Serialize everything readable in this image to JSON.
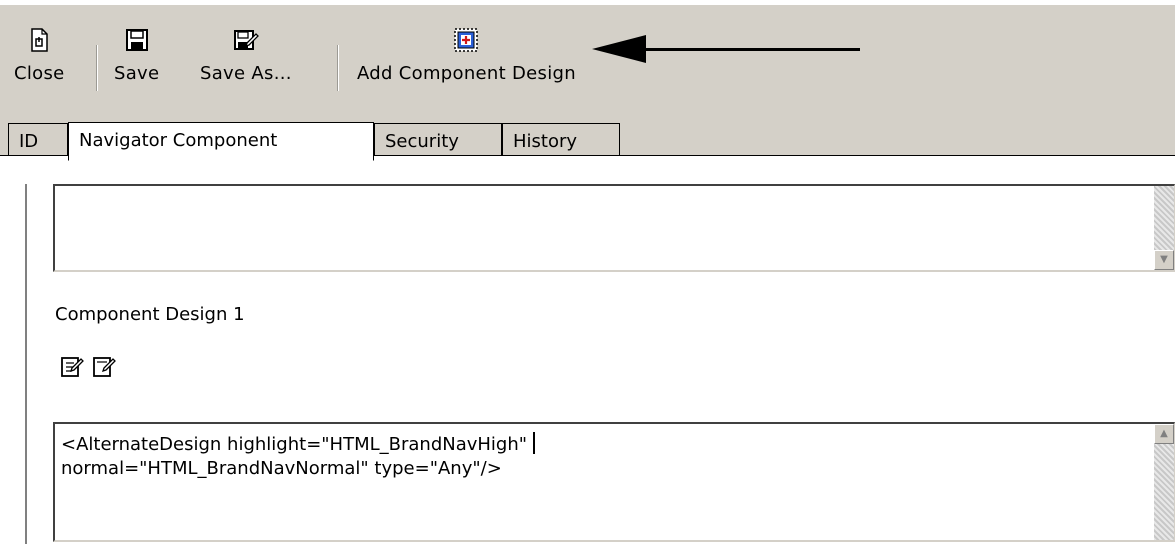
{
  "toolbar": {
    "close_label": "Close",
    "save_label": "Save",
    "save_as_label": "Save As...",
    "add_component_design_label": "Add Component Design"
  },
  "tabs": [
    {
      "label": "ID"
    },
    {
      "label": "Navigator Component"
    },
    {
      "label": "Security"
    },
    {
      "label": "History"
    }
  ],
  "section": {
    "title": "Component Design 1"
  },
  "design_editor": {
    "line1": "<AlternateDesign highlight=\"HTML_BrandNavHigh\"",
    "line2": "normal=\"HTML_BrandNavNormal\" type=\"Any\"/>"
  },
  "colors": {
    "toolbar_bg": "#d4d0c8",
    "annotation_arrow": "#000000"
  }
}
